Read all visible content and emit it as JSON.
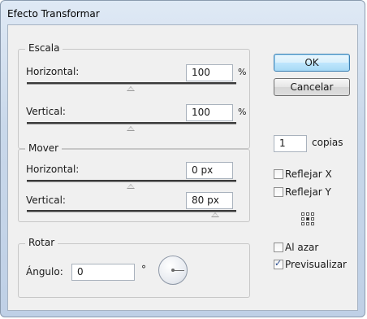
{
  "window": {
    "title": "Efecto Transformar"
  },
  "escala": {
    "title": "Escala",
    "horizontal": {
      "label": "Horizontal:",
      "value": "100",
      "unit": "%",
      "slider_level": 0.5
    },
    "vertical": {
      "label": "Vertical:",
      "value": "100",
      "unit": "%",
      "slider_level": 0.5
    }
  },
  "mover": {
    "title": "Mover",
    "horizontal": {
      "label": "Horizontal:",
      "value": "0 px",
      "slider_level": 0.5
    },
    "vertical": {
      "label": "Vertical:",
      "value": "80 px",
      "slider_level": 0.9
    }
  },
  "rotar": {
    "title": "Rotar",
    "angle_label": "Ángulo:",
    "angle_value": "0",
    "degree_symbol": "°"
  },
  "buttons": {
    "ok": "OK",
    "cancel": "Cancelar"
  },
  "copias": {
    "value": "1",
    "label": "copias"
  },
  "options": {
    "reflejar_x": {
      "label": "Reflejar X",
      "checked": false
    },
    "reflejar_y": {
      "label": "Reflejar Y",
      "checked": false
    },
    "al_azar": {
      "label": "Al azar",
      "checked": false
    },
    "previsualizar": {
      "label": "Previsualizar",
      "checked": true
    }
  },
  "reference_point": {
    "icon": "reference-point-grid-icon",
    "selected": "center"
  }
}
